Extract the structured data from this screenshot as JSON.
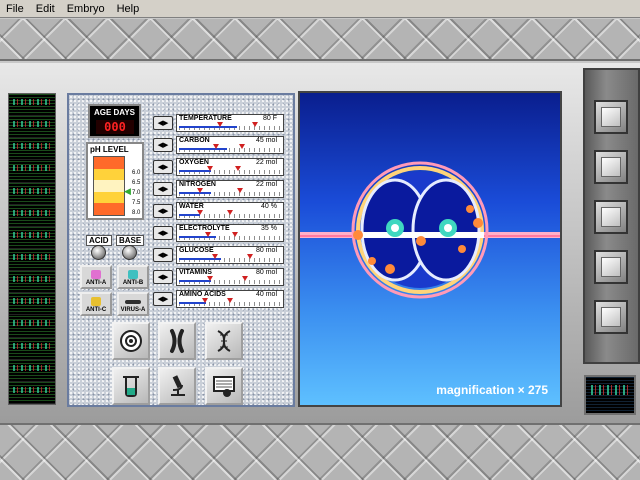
{
  "menu": [
    "File",
    "Edit",
    "Embryo",
    "Help"
  ],
  "age": {
    "label": "AGE DAYS",
    "value": "000"
  },
  "ph": {
    "title": "pH LEVEL",
    "scale": [
      "6.0",
      "6.5",
      "7.0",
      "7.5",
      "8.0"
    ],
    "bands": [
      "#ff6a2a",
      "#ffd23a",
      "#fff3c0",
      "#ffd23a",
      "#ff6a2a"
    ],
    "acid_label": "ACID",
    "base_label": "BASE"
  },
  "anti": [
    {
      "label": "ANTI-A",
      "color": "#e070d0"
    },
    {
      "label": "ANTI-B",
      "color": "#40c0c0"
    },
    {
      "label": "ANTI-C",
      "color": "#e8c030"
    },
    {
      "label": "VIRUS-A",
      "color": "#303030"
    }
  ],
  "gauges": [
    {
      "name": "TEMPERATURE",
      "value": "80 F",
      "level": 0.55
    },
    {
      "name": "CARBON",
      "value": "45 mol",
      "level": 0.45
    },
    {
      "name": "OXYGEN",
      "value": "22 mol",
      "level": 0.3
    },
    {
      "name": "NITROGEN",
      "value": "22 mol",
      "level": 0.3
    },
    {
      "name": "WATER",
      "value": "40 %",
      "level": 0.2
    },
    {
      "name": "ELECTROLYTE",
      "value": "35 %",
      "level": 0.35
    },
    {
      "name": "GLUCOSE",
      "value": "80 mol",
      "level": 0.4
    },
    {
      "name": "VITAMINS",
      "value": "80 mol",
      "level": 0.3
    },
    {
      "name": "AMINO ACIDS",
      "value": "40 mol",
      "level": 0.25
    }
  ],
  "tools": [
    {
      "name": "cell-view-icon"
    },
    {
      "name": "chromosome-icon"
    },
    {
      "name": "dna-helix-icon"
    },
    {
      "name": "beaker-icon"
    },
    {
      "name": "microscope-icon"
    },
    {
      "name": "monitor-scan-icon"
    }
  ],
  "viewer": {
    "magnification": "magnification × 275"
  }
}
